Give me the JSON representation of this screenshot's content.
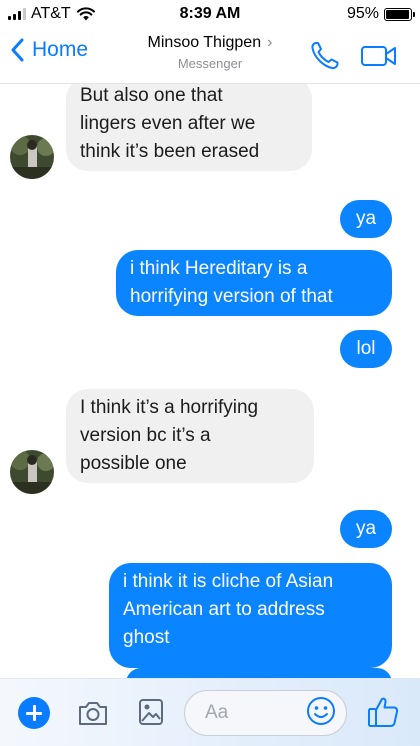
{
  "status_bar": {
    "carrier": "AT&T",
    "time": "8:39 AM",
    "battery": "95%",
    "battery_level": 0.95
  },
  "header": {
    "back_label": "Home",
    "contact_name": "Minsoo Thigpen",
    "chevron": "›",
    "subtitle": "Messenger",
    "icons": [
      "back-chevron-icon",
      "phone-icon",
      "video-camera-icon"
    ],
    "accent_color": "#0a7cff"
  },
  "messages": [
    {
      "from": "contact",
      "text": "But also one that\nlingers even after we\nthink it’s been erased"
    },
    {
      "from": "me",
      "text": "ya"
    },
    {
      "from": "me",
      "text": "i think Hereditary is a\nhorrifying version of that"
    },
    {
      "from": "me",
      "text": "lol"
    },
    {
      "from": "contact",
      "text": "I think it’s a horrifying\nversion bc it’s a\npossible one"
    },
    {
      "from": "me",
      "text": "ya"
    },
    {
      "from": "me",
      "text": "i think it is cliche of Asian\nAmerican art  to address\nghost"
    }
  ],
  "colors": {
    "sent_bubble": "#0a84ff",
    "received_bubble": "#f1f0f0"
  },
  "composer": {
    "placeholder": "Aa",
    "icons": [
      "plus-icon",
      "camera-icon",
      "gallery-icon",
      "emoji-icon",
      "thumbs-up-icon"
    ]
  }
}
